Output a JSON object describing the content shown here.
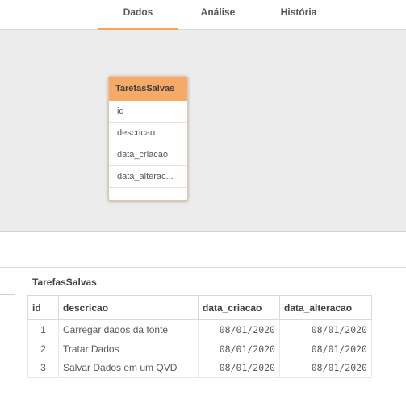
{
  "tabs": [
    {
      "label": "Dados",
      "active": true
    },
    {
      "label": "Análise",
      "active": false
    },
    {
      "label": "História",
      "active": false
    }
  ],
  "model_viewer": {
    "table": {
      "name": "TarefasSalvas",
      "fields": [
        "id",
        "descricao",
        "data_criacao",
        "data_alterac..."
      ]
    }
  },
  "preview": {
    "title": "TarefasSalvas",
    "columns": [
      "id",
      "descricao",
      "data_criacao",
      "data_alteracao"
    ],
    "rows": [
      [
        "1",
        "Carregar dados da fonte",
        "08/01/2020",
        "08/01/2020"
      ],
      [
        "2",
        "Tratar Dados",
        "08/01/2020",
        "08/01/2020"
      ],
      [
        "3",
        "Salvar Dados em um QVD",
        "08/01/2020",
        "08/01/2020"
      ]
    ]
  },
  "colors": {
    "accent": "#f0a65a",
    "table_header": "#f5aa68",
    "canvas_bg": "#ececec"
  }
}
